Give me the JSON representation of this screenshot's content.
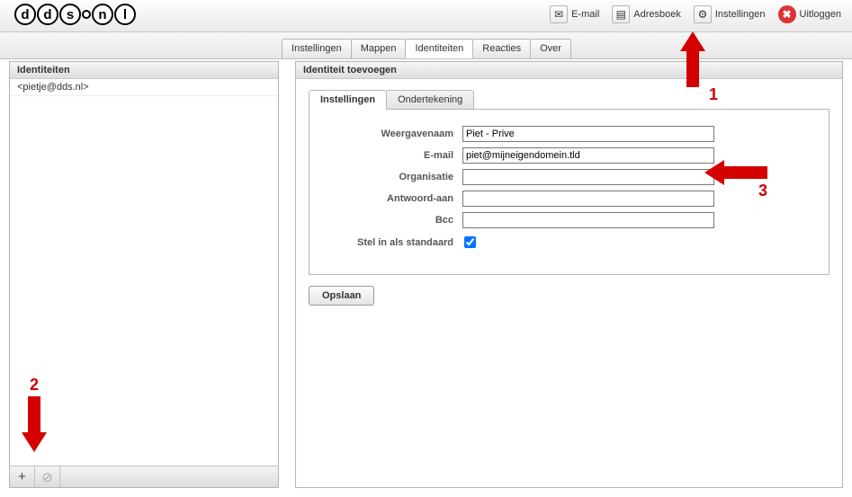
{
  "topnav": {
    "email": {
      "label": "E-mail",
      "icon": "✉"
    },
    "address": {
      "label": "Adresboek",
      "icon": "▤"
    },
    "settings": {
      "label": "Instellingen",
      "icon": "⚙"
    },
    "logout": {
      "label": "Uitloggen",
      "icon": "✖"
    }
  },
  "tabs": {
    "settings": "Instellingen",
    "folders": "Mappen",
    "identities": "Identiteiten",
    "responses": "Reacties",
    "about": "Over"
  },
  "left": {
    "title": "Identiteiten",
    "items": [
      {
        "label": "<pietje@dds.nl>"
      }
    ]
  },
  "right": {
    "title": "Identiteit toevoegen",
    "inner_tabs": {
      "settings": "Instellingen",
      "signature": "Ondertekening"
    },
    "form": {
      "display_name": {
        "label": "Weergavenaam",
        "value": "Piet - Prive"
      },
      "email": {
        "label": "E-mail",
        "value": "piet@mijneigendomein.tld"
      },
      "organisation": {
        "label": "Organisatie",
        "value": ""
      },
      "reply_to": {
        "label": "Antwoord-aan",
        "value": ""
      },
      "bcc": {
        "label": "Bcc",
        "value": ""
      },
      "set_default": {
        "label": "Stel in als standaard",
        "checked": true
      }
    },
    "save_label": "Opslaan"
  },
  "annotations": {
    "a1": "1",
    "a2": "2",
    "a3": "3"
  }
}
